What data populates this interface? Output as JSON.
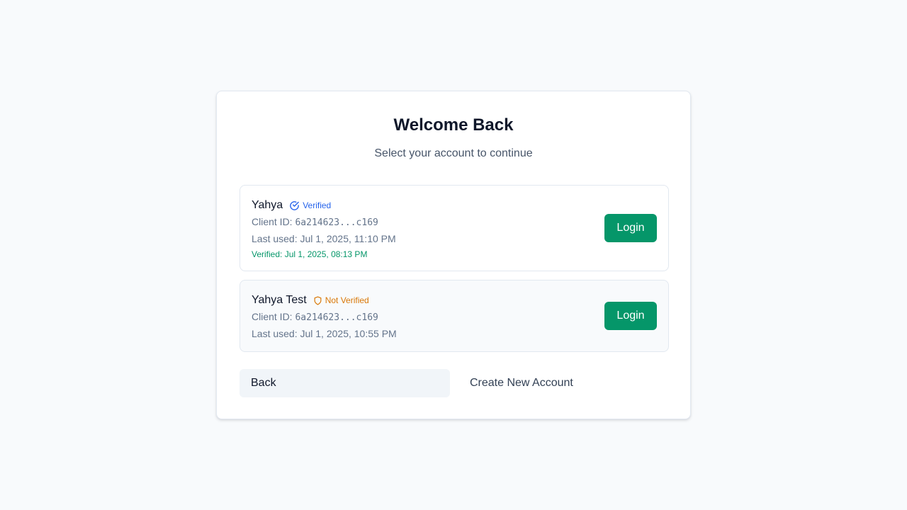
{
  "header": {
    "title": "Welcome Back",
    "subtitle": "Select your account to continue"
  },
  "accounts": [
    {
      "name": "Yahya",
      "badge": "Verified",
      "badge_icon": "check-circle-icon",
      "client_id_label": "Client ID: ",
      "client_id": "6a214623...c169",
      "last_used": "Last used: Jul 1, 2025, 11:10 PM",
      "verified_at": "Verified: Jul 1, 2025, 08:13 PM",
      "login_label": "Login"
    },
    {
      "name": "Yahya Test",
      "badge": "Not Verified",
      "badge_icon": "shield-icon",
      "client_id_label": "Client ID: ",
      "client_id": "6a214623...c169",
      "last_used": "Last used: Jul 1, 2025, 10:55 PM",
      "login_label": "Login"
    }
  ],
  "footer": {
    "back_label": "Back",
    "create_label": "Create New Account"
  },
  "colors": {
    "primary": "#059669",
    "verified": "#2563eb",
    "not_verified": "#d97706",
    "background": "#f8fafc"
  }
}
